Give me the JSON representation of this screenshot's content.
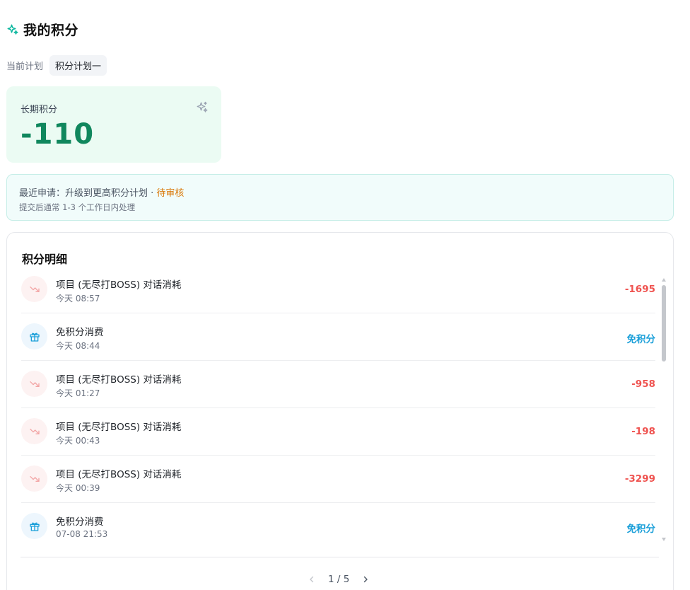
{
  "header": {
    "title": "我的积分",
    "icon": "sparkle-icon",
    "accent": "#10b8a0"
  },
  "plan": {
    "label": "当前计划",
    "current": "积分计划一"
  },
  "points_card": {
    "label": "长期积分",
    "value": "-110",
    "color": "#10875d"
  },
  "notice": {
    "prefix": "最近申请：升级到更高积分计划 · ",
    "status": "待审核",
    "hint": "提交后通常 1-3 个工作日内处理"
  },
  "detail": {
    "title": "积分明细",
    "items": [
      {
        "type": "consume",
        "icon": "trending-down-icon",
        "title": "项目 (无尽打BOSS) 对话消耗",
        "time": "今天 08:57",
        "amount": "-1695"
      },
      {
        "type": "free",
        "icon": "gift-icon",
        "title": "免积分消费",
        "time": "今天 08:44",
        "amount": "免积分"
      },
      {
        "type": "consume",
        "icon": "trending-down-icon",
        "title": "项目 (无尽打BOSS) 对话消耗",
        "time": "今天 01:27",
        "amount": "-958"
      },
      {
        "type": "consume",
        "icon": "trending-down-icon",
        "title": "项目 (无尽打BOSS) 对话消耗",
        "time": "今天 00:43",
        "amount": "-198"
      },
      {
        "type": "consume",
        "icon": "trending-down-icon",
        "title": "项目 (无尽打BOSS) 对话消耗",
        "time": "今天 00:39",
        "amount": "-3299"
      },
      {
        "type": "free",
        "icon": "gift-icon",
        "title": "免积分消费",
        "time": "07-08 21:53",
        "amount": "免积分"
      }
    ]
  },
  "pagination": {
    "text": "1 / 5",
    "current": 1,
    "total": 5
  },
  "colors": {
    "negative": "#ef5350",
    "free": "#1a9fd9",
    "pending": "#d97706"
  }
}
